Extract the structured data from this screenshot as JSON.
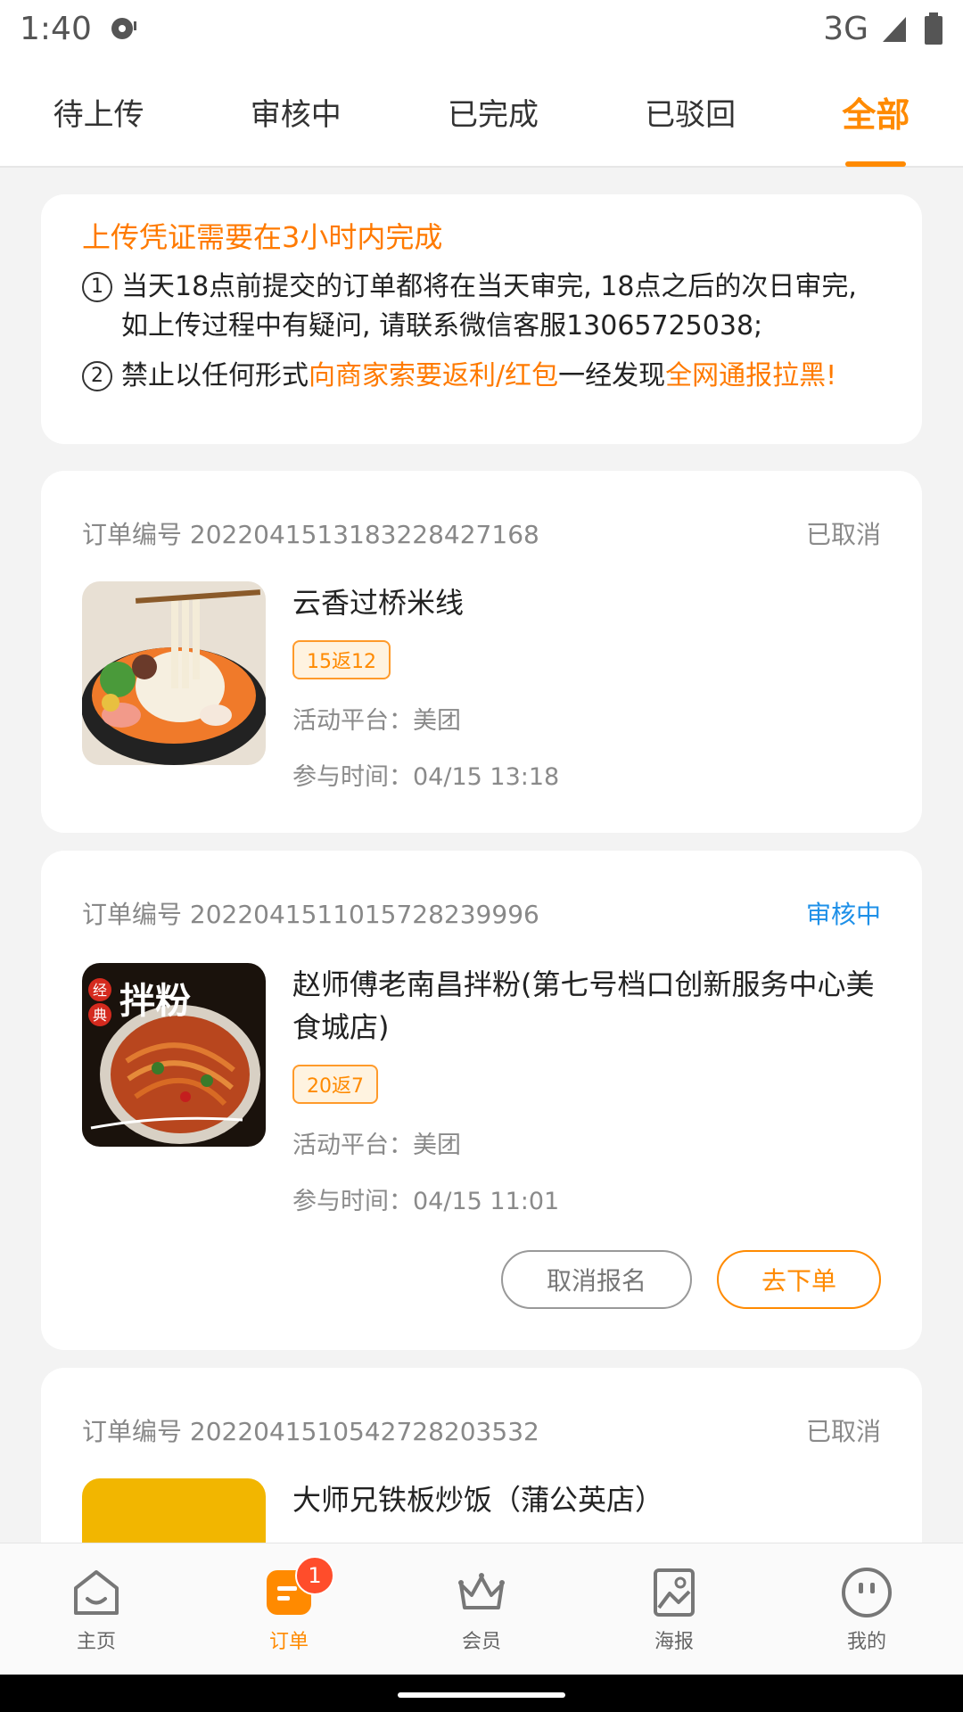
{
  "status_bar": {
    "time": "1:40",
    "network": "3G"
  },
  "tabs": [
    {
      "label": "待上传"
    },
    {
      "label": "审核中"
    },
    {
      "label": "已完成"
    },
    {
      "label": "已驳回"
    },
    {
      "label": "全部"
    }
  ],
  "active_tab": "全部",
  "notice": {
    "title": "上传凭证需要在3小时内完成",
    "item1_num": "①",
    "item1_text": "当天18点前提交的订单都将在当天审完, 18点之后的次日审完, 如上传过程中有疑问, 请联系微信客服13065725038;",
    "item2_num": "②",
    "item2_part1": "禁止以任何形式",
    "item2_part2": "向商家索要返利/红包",
    "item2_part3": "一经发现",
    "item2_part4": "全网通报拉黑!"
  },
  "orders": [
    {
      "order_no": "订单编号 2022041513183228427168",
      "status": "已取消",
      "shop": "云香过桥米线",
      "tag": "15返12",
      "platform": "活动平台：美团",
      "time": "参与时间：04/15 13:18"
    },
    {
      "order_no": "订单编号 2022041511015728239996",
      "status": "审核中",
      "shop": "赵师傅老南昌拌粉(第七号档口创新服务中心美食城店)",
      "tag": "20返7",
      "platform": "活动平台：美团",
      "time": "参与时间：04/15 11:01",
      "thumb_text_1": "经",
      "thumb_text_2": "典",
      "thumb_text_3": "拌粉",
      "cancel_label": "取消报名",
      "order_label": "去下单"
    },
    {
      "order_no": "订单编号 2022041510542728203532",
      "status": "已取消",
      "shop": "大师兄铁板炒饭（蒲公英店）"
    }
  ],
  "bottom_nav": [
    {
      "label": "主页",
      "icon": "home-icon"
    },
    {
      "label": "订单",
      "icon": "order-icon",
      "badge": "1"
    },
    {
      "label": "会员",
      "icon": "crown-icon"
    },
    {
      "label": "海报",
      "icon": "poster-icon"
    },
    {
      "label": "我的",
      "icon": "profile-icon"
    }
  ],
  "colors": {
    "accent": "#ff8a00",
    "status_blue": "#1e90e8",
    "badge": "#ff4d2b"
  }
}
